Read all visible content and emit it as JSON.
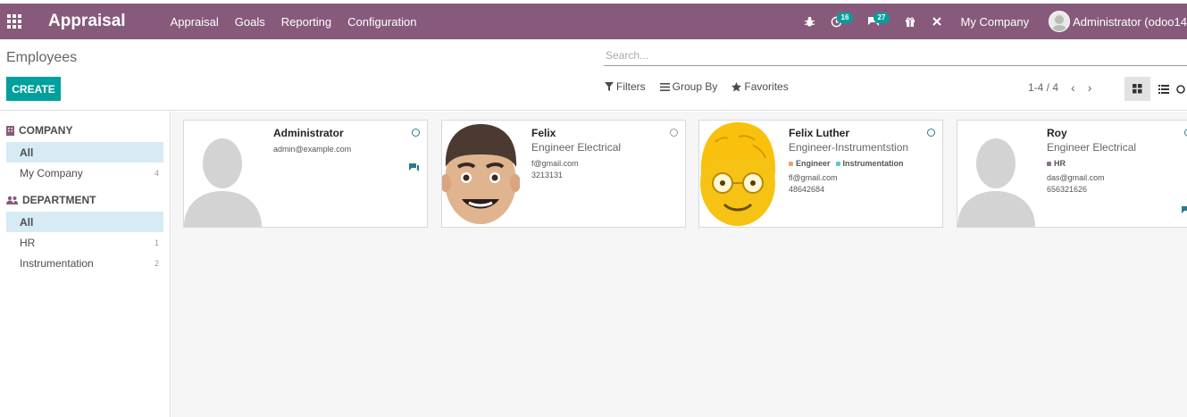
{
  "nav": {
    "brand": "Appraisal",
    "menu": [
      "Appraisal",
      "Goals",
      "Reporting",
      "Configuration"
    ],
    "activity_badge": "16",
    "messages_badge": "27",
    "company": "My Company",
    "user": "Administrator (odoo14"
  },
  "control": {
    "breadcrumb": "Employees",
    "create_label": "CREATE",
    "search_placeholder": "Search...",
    "filters_label": "Filters",
    "groupby_label": "Group By",
    "favorites_label": "Favorites",
    "pager": "1-4 / 4"
  },
  "sidebar": {
    "company_header": "COMPANY",
    "company_items": [
      {
        "label": "All",
        "count": ""
      },
      {
        "label": "My Company",
        "count": "4"
      }
    ],
    "department_header": "DEPARTMENT",
    "department_items": [
      {
        "label": "All",
        "count": ""
      },
      {
        "label": "HR",
        "count": "1"
      },
      {
        "label": "Instrumentation",
        "count": "2"
      }
    ]
  },
  "employees": [
    {
      "name": "Administrator",
      "job": "",
      "email": "admin@example.com",
      "phone": "",
      "tags": []
    },
    {
      "name": "Felix",
      "job": "Engineer Electrical",
      "email": "f@gmail.com",
      "phone": "3213131",
      "tags": []
    },
    {
      "name": "Felix Luther",
      "job": "Engineer-Instrumentstion",
      "email": "fl@gmail.com",
      "phone": "48642684",
      "tags": [
        "Engineer",
        "Instrumentation"
      ]
    },
    {
      "name": "Roy",
      "job": "Engineer Electrical",
      "email": "das@gmail.com",
      "phone": "656321626",
      "tags": [
        "HR"
      ]
    }
  ],
  "colors": {
    "navbar": "#875a7b",
    "primary": "#00a09d",
    "tag_engineer": "#e9a36c",
    "tag_instrumentation": "#5fc8d6",
    "tag_hr": "#8b6f8f"
  }
}
